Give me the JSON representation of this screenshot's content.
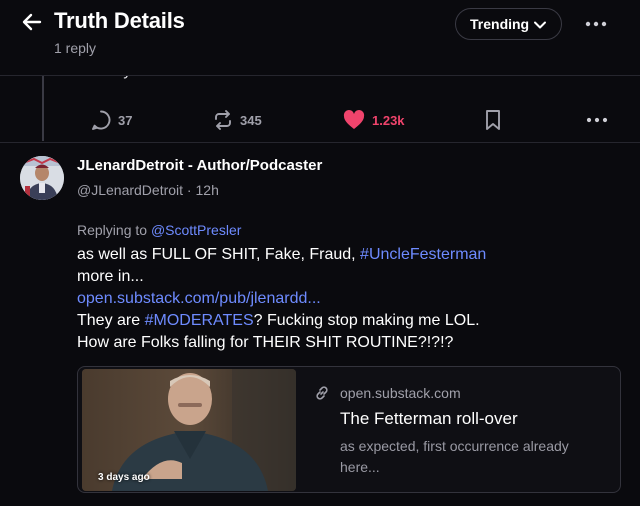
{
  "header": {
    "title": "Truth Details",
    "subtitle": "1 reply",
    "sort_label": "Trending",
    "back_icon": "arrow-left-icon",
    "more_icon": "ellipsis-icon"
  },
  "parent_post": {
    "cut_text": "Pennsylvania the next Florida.",
    "actions": {
      "replies": "37",
      "retruths": "345",
      "likes": "1.23k"
    },
    "like_color": "#f0446c"
  },
  "reply_post": {
    "author_name": "JLenardDetroit - Author/Podcaster",
    "handle": "@JLenardDetroit",
    "separator": " · ",
    "time": "12h",
    "replying_prefix": "Replying to ",
    "replying_to": "@ScottPresler",
    "body": {
      "line1_text": "as well as FULL OF SHIT, Fake, Fraud, ",
      "line1_tag": "#UncleFesterman",
      "line2": "more in...",
      "line3_link": "open.substack.com/pub/jlenardd...",
      "line4_pre": "They are ",
      "line4_tag": "#MODERATES",
      "line4_post": "? Fucking stop making me LOL.",
      "line5": "How are Folks falling for THEIR SHIT ROUTINE?!?!?"
    },
    "card": {
      "thumb_badge": "3 days ago",
      "domain": "open.substack.com",
      "title": "The Fetterman roll-over",
      "description": "as expected, first occurrence already here..."
    }
  },
  "colors": {
    "background": "#0a0a0e",
    "link": "#6e8bff",
    "muted": "#a0a0aa"
  }
}
